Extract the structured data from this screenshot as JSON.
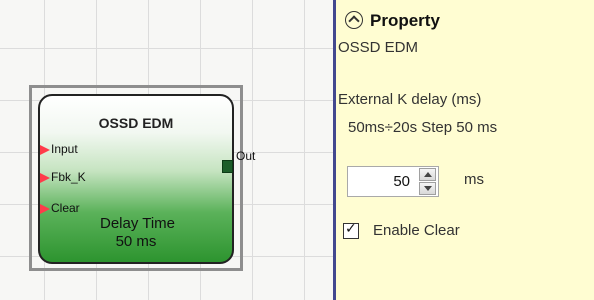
{
  "diagram": {
    "block": {
      "title": "OSSD EDM",
      "inputs": [
        "Input",
        "Fbk_K",
        "Clear"
      ],
      "output": "Out",
      "delay_title": "Delay Time",
      "delay_value": "50 ms"
    }
  },
  "property_panel": {
    "collapse_icon": "chevron-up-circle-icon",
    "title": "Property",
    "subtitle": "OSSD EDM",
    "field_label": "External K delay (ms)",
    "range_text": "50ms÷20s Step 50 ms",
    "delay_value": "50",
    "unit": "ms",
    "enable_clear": {
      "label": "Enable Clear",
      "checked": true
    }
  },
  "colors": {
    "panel_bg": "#fffdd2",
    "divider": "#43488f",
    "input_pin": "#ff3b4a",
    "output_pin": "#1d5e2a"
  }
}
